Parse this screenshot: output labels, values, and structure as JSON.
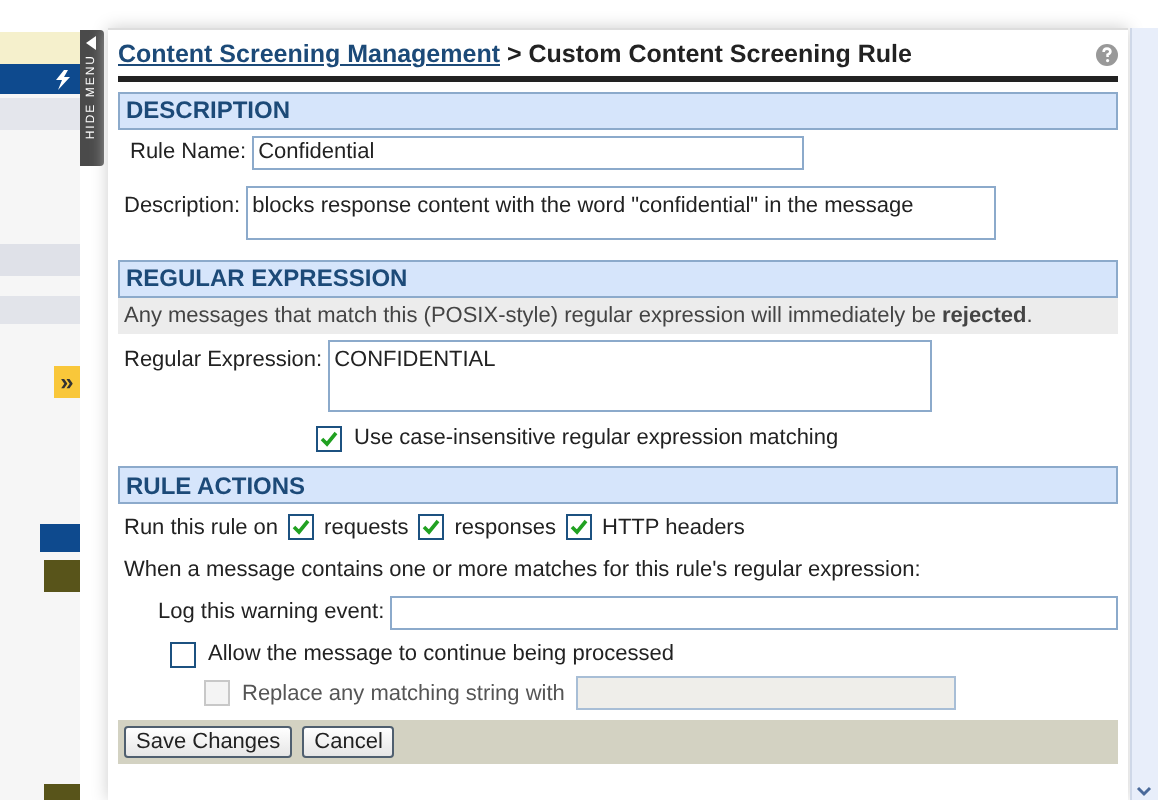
{
  "side_menu": {
    "toggle_label": "HIDE MENU",
    "expand_glyph": "»"
  },
  "header": {
    "breadcrumb_link": "Content Screening Management",
    "separator": ">",
    "title": "Custom Content Screening Rule"
  },
  "description_section": {
    "heading": "DESCRIPTION",
    "rule_name_label": "Rule Name:",
    "rule_name_value": "Confidential",
    "description_label": "Description:",
    "description_value": "blocks response content with the word \"confidential\" in the message"
  },
  "regex_section": {
    "heading": "REGULAR EXPRESSION",
    "note": "Any messages that match this (POSIX-style) regular expression will immediately be **rejected**.",
    "regex_label": "Regular Expression:",
    "regex_value": "CONFIDENTIAL",
    "case_insensitive": {
      "label": "Use case-insensitive regular expression matching",
      "checked": true
    }
  },
  "actions_section": {
    "heading": "RULE ACTIONS",
    "run_on_label": "Run this rule on",
    "run_on": [
      {
        "label": "requests",
        "checked": true
      },
      {
        "label": "responses",
        "checked": true
      },
      {
        "label": "HTTP headers",
        "checked": true
      }
    ],
    "match_text": "When a message contains one or more matches for this rule's regular expression:",
    "log_label": "Log this warning event:",
    "allow": {
      "label": "Allow the message to continue being processed",
      "checked": false
    },
    "replace": {
      "label": "Replace any matching string with",
      "checked": false,
      "disabled": true
    }
  },
  "buttons": [
    "Save Changes",
    "Cancel"
  ]
}
